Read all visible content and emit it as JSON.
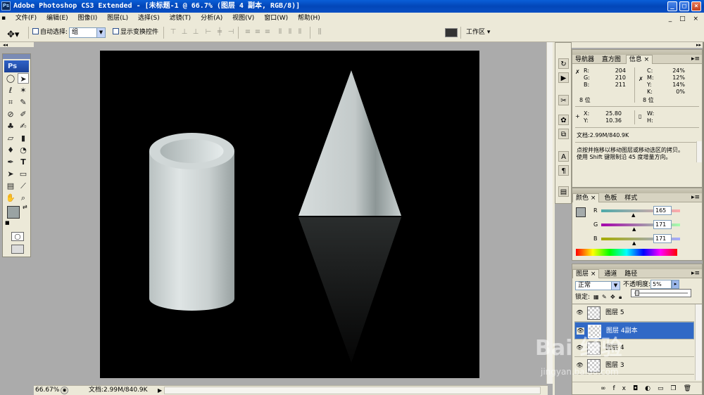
{
  "window": {
    "title": "Adobe Photoshop CS3 Extended - [未标题-1 @ 66.7% (图层 4 副本, RGB/8)]",
    "app_icon": "Ps",
    "controls": [
      "_",
      "□",
      "×"
    ],
    "doc_controls": [
      "_",
      "□",
      "×"
    ]
  },
  "menu": [
    "文件(F)",
    "编辑(E)",
    "图像(I)",
    "图层(L)",
    "选择(S)",
    "滤镜(T)",
    "分析(A)",
    "视图(V)",
    "窗口(W)",
    "帮助(H)"
  ],
  "options": {
    "auto_select_label": "自动选择:",
    "auto_select_value": "组",
    "show_transform_label": "显示变换控件",
    "workspace_label": "工作区 ▾"
  },
  "toolbox": {
    "logo": "Ps",
    "tools": [
      "marquee-icon",
      "move-icon",
      "lasso-icon",
      "magic-wand-icon",
      "crop-icon",
      "slice-icon",
      "healing-icon",
      "brush-icon",
      "stamp-icon",
      "history-brush-icon",
      "eraser-icon",
      "gradient-icon",
      "blur-icon",
      "dodge-icon",
      "pen-icon",
      "type-icon",
      "path-select-icon",
      "shape-icon",
      "notes-icon",
      "eyedropper-icon",
      "hand-icon",
      "zoom-icon"
    ],
    "foreground_color": "#9aa3a3",
    "background_color": "#ffffff"
  },
  "status": {
    "zoom": "66.67%",
    "doc_info": "文档:2.99M/840.9K"
  },
  "info_panel": {
    "tabs": [
      "导航器",
      "直方图",
      "信息"
    ],
    "active_tab": "信息",
    "r_label": "R:",
    "r": "204",
    "g_label": "G:",
    "g": "210",
    "b_label": "B:",
    "b": "211",
    "c_label": "C:",
    "c": "24%",
    "m_label": "M:",
    "m": "12%",
    "y_label": "Y:",
    "y": "14%",
    "k_label": "K:",
    "k": "0%",
    "bits_left": "8 位",
    "bits_right": "8 位",
    "x_label": "X:",
    "x": "25.80",
    "y2_label": "Y:",
    "y2": "10.36",
    "w_label": "W:",
    "h_label": "H:",
    "doc_info": "文档:2.99M/840.9K",
    "hint_line1": "点按并拖移以移动图层或移动选区的拷贝。",
    "hint_line2": "使用 Shift 键限制沿 45 度增量方向。"
  },
  "color_panel": {
    "tabs": [
      "颜色",
      "色板",
      "样式"
    ],
    "active_tab": "颜色",
    "r_label": "R",
    "r": "165",
    "g_label": "G",
    "g": "171",
    "b_label": "B",
    "b": "171",
    "swatch_color": "#a5abab"
  },
  "layers_panel": {
    "tabs": [
      "图层",
      "通道",
      "路径"
    ],
    "active_tab": "图层",
    "blend_mode": "正常",
    "opacity_label": "不透明度:",
    "opacity": "5%",
    "opacity_fraction": 0.05,
    "lock_label": "锁定:",
    "layers": [
      {
        "name": "图层 5",
        "selected": false
      },
      {
        "name": "图层 4副本",
        "selected": true
      },
      {
        "name": "图层 4",
        "selected": false
      },
      {
        "name": "图层 3",
        "selected": false
      }
    ]
  },
  "watermark": {
    "brand": "Bai 经验",
    "url": "jingyan.baidu.com"
  }
}
